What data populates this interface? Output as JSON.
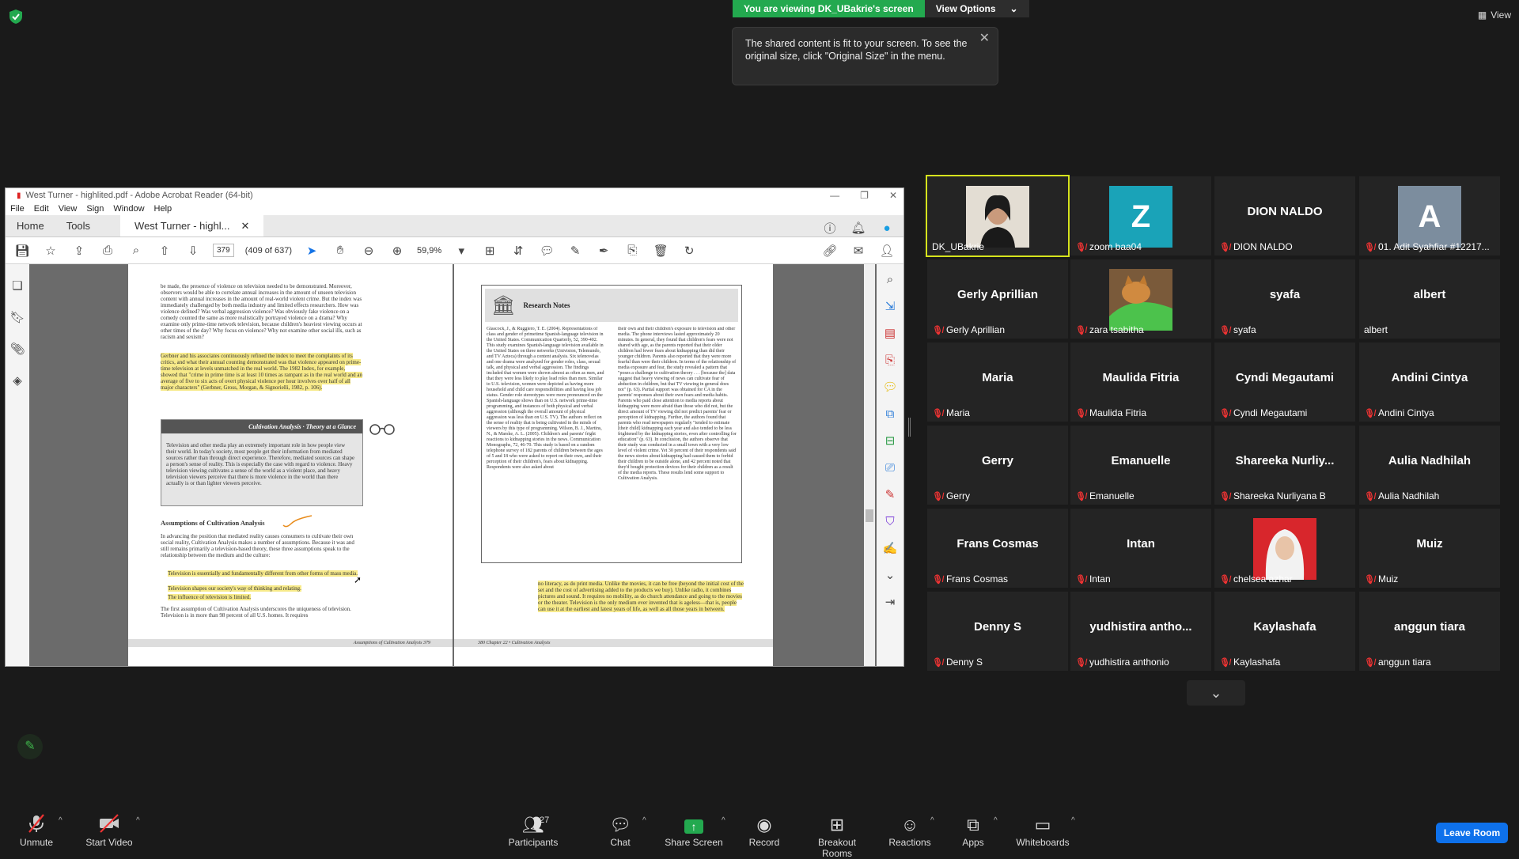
{
  "banner": {
    "viewing": "You are viewing DK_UBakrie's screen",
    "view_options": "View Options",
    "tooltip": "The shared content is fit to your screen. To see the original size, click \"Original Size\" in the menu.",
    "view_btn": "View"
  },
  "acrobat": {
    "title": "West Turner - highlited.pdf - Adobe Acrobat Reader (64-bit)",
    "menu": [
      "File",
      "Edit",
      "View",
      "Sign",
      "Window",
      "Help"
    ],
    "tab_home": "Home",
    "tab_tools": "Tools",
    "doc_tab": "West Turner - highl...",
    "page_num": "379",
    "page_count": "(409 of 637)",
    "zoom": "59,9%",
    "page_left": {
      "para1": "be made, the presence of violence on television needed to be demonstrated. Moreover, observers would be able to correlate annual increases in the amount of unseen television content with annual increases in the amount of real-world violent crime. But the index was immediately challenged by both media industry and limited effects researchers. How was violence defined? Was verbal aggression violence? Was obviously fake violence on a comedy counted the same as more realistically portrayed violence on a drama? Why examine only prime-time network television, because children's heaviest viewing occurs at other times of the day? Why focus on violence? Why not examine other social ills, such as racism and sexism?",
      "para2": "Gerbner and his associates continuously refined the index to meet the complaints of its critics, and what their annual counting demonstrated was that violence appeared on prime-time television at levels unmatched in the real world. The 1982 Index, for example, showed that \"crime in prime time is at least 10 times as rampant as in the real world and an average of five to six acts of overt physical violence per hour involves over half of all major characters\" (Gerbner, Gross, Morgan, & Signorielli, 1982, p. 106).",
      "box_title": "Cultivation Analysis · Theory at a Glance",
      "box_text": "Television and other media play an extremely important role in how people view their world. In today's society, most people get their information from mediated sources rather than through direct experience. Therefore, mediated sources can shape a person's sense of reality. This is especially the case with regard to violence. Heavy television viewing cultivates a sense of the world as a violent place, and heavy television viewers perceive that there is more violence in the world than there actually is or than lighter viewers perceive.",
      "heading": "Assumptions of Cultivation Analysis",
      "para3": "In advancing the position that mediated reality causes consumers to cultivate their own social reality, Cultivation Analysis makes a number of assumptions. Because it was and still remains primarily a television-based theory, these three assumptions speak to the relationship between the medium and the culture:",
      "bullet1": "Television is essentially and fundamentally different from other forms of mass media.",
      "bullet2": "Television shapes our society's way of thinking and relating.",
      "bullet3": "The influence of television is limited.",
      "para4": "The first assumption of Cultivation Analysis underscores the uniqueness of television. Television is in more than 98 percent of all U.S. homes. It requires",
      "footer": "Assumptions of Cultivation Analysis   379"
    },
    "page_right": {
      "research_title": "Research Notes",
      "col1": "Glascock, J., & Ruggiero, T. E. (2004). Representations of class and gender of primetime Spanish-language television in the United States. Communication Quarterly, 52, 390-402. This study examines Spanish-language television available in the United States on three networks (Univision, Telemundo, and TV Azteca) through a content analysis. Six telenovelas and one drama were analyzed for gender roles, class, sexual talk, and physical and verbal aggression. The findings included that women were shown almost as often as men, and that they were less likely to play lead roles than men. Similar to U.S. television, women were depicted as having more household and child care responsibilities and having less job status. Gender role stereotypes were more pronounced on the Spanish-language shows than on U.S. network prime-time programming, and instances of both physical and verbal aggression (although the overall amount of physical aggression was less than on U.S. TV). The authors reflect on the sense of reality that is being cultivated in the minds of viewers by this type of programming. Wilson, B. J., Martins, N., & Marske, A. L. (2005). Children's and parents' fright reactions to kidnapping stories in the news. Communication Monographs, 72, 46-70. This study is based on a random telephone survey of 182 parents of children between the ages of 5 and 18 who were asked to report on their own, and their perception of their children's, fears about kidnapping. Respondents were also asked about",
      "col2": "their own and their children's exposure to television and other media. The phone interviews lasted approximately 20 minutes. In general, they found that children's fears were not shared with age, as the parents reported that their older children had fewer fears about kidnapping than did their younger children. Parents also reported that they were more fearful than were their children. In terms of the relationship of media exposure and fear, the study revealed a pattern that \"poses a challenge to cultivation theory . . . [because the] data suggest that heavy viewing of news can cultivate fear of abduction in children, but that TV viewing in general does not\" (p. 63). Partial support was obtained for CA in the parents' responses about their own fears and media habits. Parents who paid close attention to media reports about kidnapping were more afraid than those who did not, but the direct amount of TV viewing did not predict parents' fear or perception of kidnapping. Further, the authors found that parents who read newspapers regularly \"tended to estimate [their child] kidnapping each year and also tended to be less frightened by the kidnapping stories, even after controlling for education\" (p. 63). In conclusion, the authors observe that their study was conducted in a small town with a very low level of violent crime. Yet 30 percent of their respondents said the news stories about kidnapping had caused them to forbid their children to be outside alone, and 42 percent noted that they'd bought protection devices for their children as a result of the media reports. These results lend some support to Cultivation Analysis.",
      "bottom": "no literacy, as do print media. Unlike the movies, it can be free (beyond the initial cost of the set and the cost of advertising added to the products we buy). Unlike radio, it combines pictures and sound. It requires no mobility, as do church attendance and going to the movies or the theater. Television is the only medium ever invented that is ageless—that is, people can use it at the earliest and latest years of life, as well as all those years in between.",
      "footer": "380   Chapter 22 • Cultivation Analysis"
    }
  },
  "participants": [
    {
      "display": "",
      "label": "DK_UBakrie",
      "muted": false,
      "kind": "photo-woman",
      "active": true
    },
    {
      "display": "Z",
      "label": "zoom baa04",
      "muted": true,
      "kind": "letter",
      "bg": "#1aa3b8"
    },
    {
      "display": "DION NALDO",
      "label": "DION NALDO",
      "muted": true,
      "kind": "name"
    },
    {
      "display": "A",
      "label": "01. Adit Syahfiar #12217...",
      "muted": true,
      "kind": "letter",
      "bg": "#7c8d9e"
    },
    {
      "display": "Gerly Aprillian",
      "label": "Gerly Aprillian",
      "muted": true,
      "kind": "name"
    },
    {
      "display": "",
      "label": "zara tsabitha",
      "muted": true,
      "kind": "photo-cat"
    },
    {
      "display": "syafa",
      "label": "syafa",
      "muted": true,
      "kind": "name"
    },
    {
      "display": "albert",
      "label": "albert",
      "muted": false,
      "kind": "name"
    },
    {
      "display": "Maria",
      "label": "Maria",
      "muted": true,
      "kind": "name"
    },
    {
      "display": "Maulida Fitria",
      "label": "Maulida Fitria",
      "muted": true,
      "kind": "name"
    },
    {
      "display": "Cyndi Megautami",
      "label": "Cyndi Megautami",
      "muted": true,
      "kind": "name"
    },
    {
      "display": "Andini Cintya",
      "label": "Andini Cintya",
      "muted": true,
      "kind": "name"
    },
    {
      "display": "Gerry",
      "label": "Gerry",
      "muted": true,
      "kind": "name"
    },
    {
      "display": "Emanuelle",
      "label": "Emanuelle",
      "muted": true,
      "kind": "name"
    },
    {
      "display": "Shareeka  Nurliy...",
      "label": "Shareeka Nurliyana B",
      "muted": true,
      "kind": "name"
    },
    {
      "display": "Aulia Nadhilah",
      "label": "Aulia Nadhilah",
      "muted": true,
      "kind": "name"
    },
    {
      "display": "Frans Cosmas",
      "label": "Frans Cosmas",
      "muted": true,
      "kind": "name"
    },
    {
      "display": "Intan",
      "label": "Intan",
      "muted": true,
      "kind": "name"
    },
    {
      "display": "",
      "label": "chelsea azhar",
      "muted": true,
      "kind": "photo-hijab"
    },
    {
      "display": "Muiz",
      "label": "Muiz",
      "muted": true,
      "kind": "name"
    },
    {
      "display": "Denny S",
      "label": "Denny S",
      "muted": true,
      "kind": "name"
    },
    {
      "display": "yudhistira  antho...",
      "label": "yudhistira anthonio",
      "muted": true,
      "kind": "name"
    },
    {
      "display": "Kaylashafa",
      "label": "Kaylashafa",
      "muted": true,
      "kind": "name"
    },
    {
      "display": "anggun tiara",
      "label": "anggun tiara",
      "muted": true,
      "kind": "name"
    }
  ],
  "toolbar": {
    "unmute": "Unmute",
    "start_video": "Start Video",
    "participants": "Participants",
    "participants_count": "27",
    "chat": "Chat",
    "share_screen": "Share Screen",
    "record": "Record",
    "breakout": "Breakout Rooms",
    "reactions": "Reactions",
    "apps": "Apps",
    "whiteboards": "Whiteboards",
    "leave": "Leave Room"
  },
  "colors": {
    "accent_green": "#23a94f",
    "leave_blue": "#0e71eb",
    "active_speaker": "#d6e31d",
    "highlight": "#f7ea8a"
  }
}
